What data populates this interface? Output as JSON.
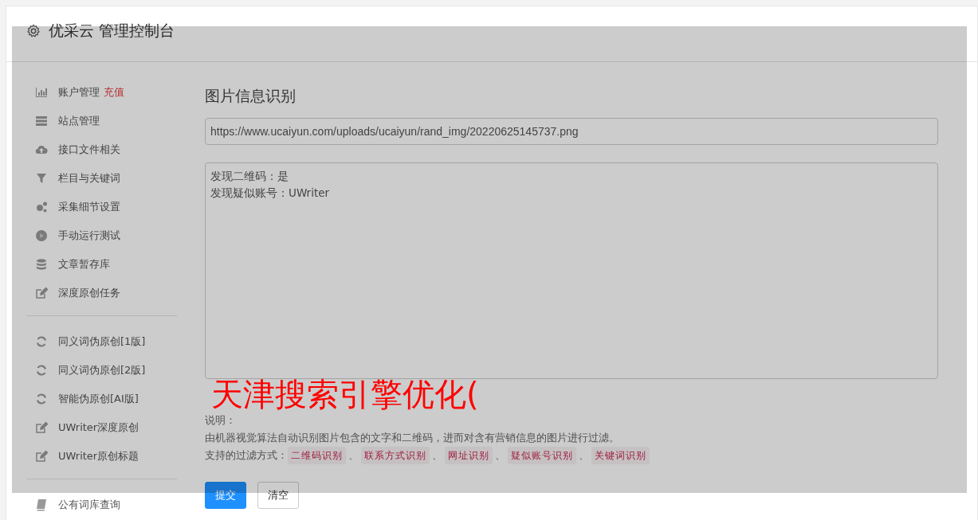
{
  "header": {
    "title": "优采云 管理控制台"
  },
  "sidebar": {
    "groups": [
      [
        {
          "label": "账户管理",
          "badge": "充值"
        },
        {
          "label": "站点管理"
        },
        {
          "label": "接口文件相关"
        },
        {
          "label": "栏目与关键词"
        },
        {
          "label": "采集细节设置"
        },
        {
          "label": "手动运行测试"
        },
        {
          "label": "文章暂存库"
        },
        {
          "label": "深度原创任务"
        }
      ],
      [
        {
          "label": "同义词伪原创[1版]"
        },
        {
          "label": "同义词伪原创[2版]"
        },
        {
          "label": "智能伪原创[AI版]"
        },
        {
          "label": "UWriter深度原创"
        },
        {
          "label": "UWriter原创标题"
        }
      ],
      [
        {
          "label": "公有词库查询"
        }
      ]
    ]
  },
  "content": {
    "title": "图片信息识别",
    "url_field": {
      "value": "https://www.ucaiyun.com/uploads/ucaiyun/rand_img/20220625145737.png"
    },
    "result_lines": [
      "发现二维码：是",
      "发现疑似账号：UWriter"
    ],
    "note_label": "说明：",
    "description": "由机器视觉算法自动识别图片包含的文字和二维码，进而对含有营销信息的图片进行过滤。",
    "filter_label": "支持的过滤方式：",
    "filters": [
      "二维码识别",
      "联系方式识别",
      "网址识别",
      "疑似账号识别",
      "关键词识别"
    ],
    "separator": "、",
    "buttons": [
      {
        "label": "提交",
        "kind": "primary"
      },
      {
        "label": "清空",
        "kind": "default"
      }
    ]
  },
  "overlay_text": "天津搜索引擎优化("
}
